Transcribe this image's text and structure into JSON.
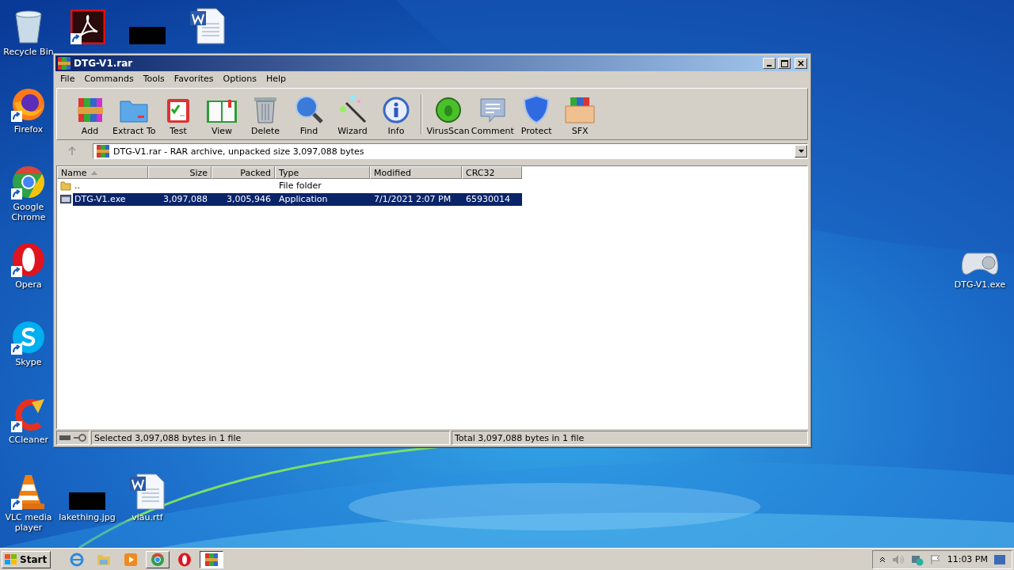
{
  "desktop_icons": [
    {
      "label": "Recycle Bin",
      "kind": "recycle"
    },
    {
      "kind": "acrobat",
      "shortcut": true
    },
    {
      "kind": "blackout"
    },
    {
      "kind": "word"
    },
    {
      "label": "Firefox",
      "kind": "firefox",
      "shortcut": true
    },
    {
      "label": "Google Chrome",
      "kind": "chrome",
      "shortcut": true
    },
    {
      "label": "Opera",
      "kind": "opera",
      "shortcut": true
    },
    {
      "label": "Skype",
      "kind": "skype",
      "shortcut": true
    },
    {
      "label": "CCleaner",
      "kind": "ccleaner",
      "shortcut": true
    },
    {
      "label": "VLC media player",
      "kind": "vlc",
      "shortcut": true
    },
    {
      "label": "lakething.jpg",
      "kind": "blackout"
    },
    {
      "label": "viau.rtf",
      "kind": "word"
    },
    {
      "label": "DTG-V1.exe",
      "kind": "exe"
    }
  ],
  "window": {
    "title": "DTG-V1.rar",
    "menu": [
      "File",
      "Commands",
      "Tools",
      "Favorites",
      "Options",
      "Help"
    ],
    "toolbar_groups": [
      [
        {
          "label": "Add",
          "kind": "add"
        },
        {
          "label": "Extract To",
          "kind": "extract"
        },
        {
          "label": "Test",
          "kind": "test"
        },
        {
          "label": "View",
          "kind": "view"
        },
        {
          "label": "Delete",
          "kind": "delete"
        },
        {
          "label": "Find",
          "kind": "find"
        },
        {
          "label": "Wizard",
          "kind": "wizard"
        },
        {
          "label": "Info",
          "kind": "info"
        }
      ],
      [
        {
          "label": "VirusScan",
          "kind": "virusscan"
        },
        {
          "label": "Comment",
          "kind": "comment"
        },
        {
          "label": "Protect",
          "kind": "protect"
        },
        {
          "label": "SFX",
          "kind": "sfx"
        }
      ]
    ],
    "address": "DTG-V1.rar - RAR archive, unpacked size 3,097,088 bytes",
    "columns": [
      {
        "label": "Name",
        "sorted": true
      },
      {
        "label": "Size",
        "sorted": false
      },
      {
        "label": "Packed",
        "sorted": false
      },
      {
        "label": "Type",
        "sorted": false
      },
      {
        "label": "Modified",
        "sorted": false
      },
      {
        "label": "CRC32",
        "sorted": false
      }
    ],
    "rows": [
      {
        "kind": "folder",
        "name": "..",
        "type": "File folder",
        "selected": false
      },
      {
        "kind": "exe",
        "name": "DTG-V1.exe",
        "size": "3,097,088",
        "packed": "3,005,946",
        "type": "Application",
        "modified": "7/1/2021 2:07 PM",
        "crc32": "65930014",
        "selected": true
      }
    ],
    "status_left": "Selected 3,097,088 bytes in 1 file",
    "status_right": "Total 3,097,088 bytes in 1 file"
  },
  "taskbar": {
    "start": "Start",
    "items": [
      {
        "kind": "ie",
        "running": false,
        "selected": false
      },
      {
        "kind": "explorer",
        "running": false,
        "selected": false
      },
      {
        "kind": "media",
        "running": false,
        "selected": false
      },
      {
        "kind": "chrome",
        "running": true,
        "selected": false
      },
      {
        "kind": "opera",
        "running": false,
        "selected": false
      },
      {
        "kind": "winrar",
        "running": true,
        "selected": true
      }
    ],
    "clock": "11:03 PM"
  }
}
